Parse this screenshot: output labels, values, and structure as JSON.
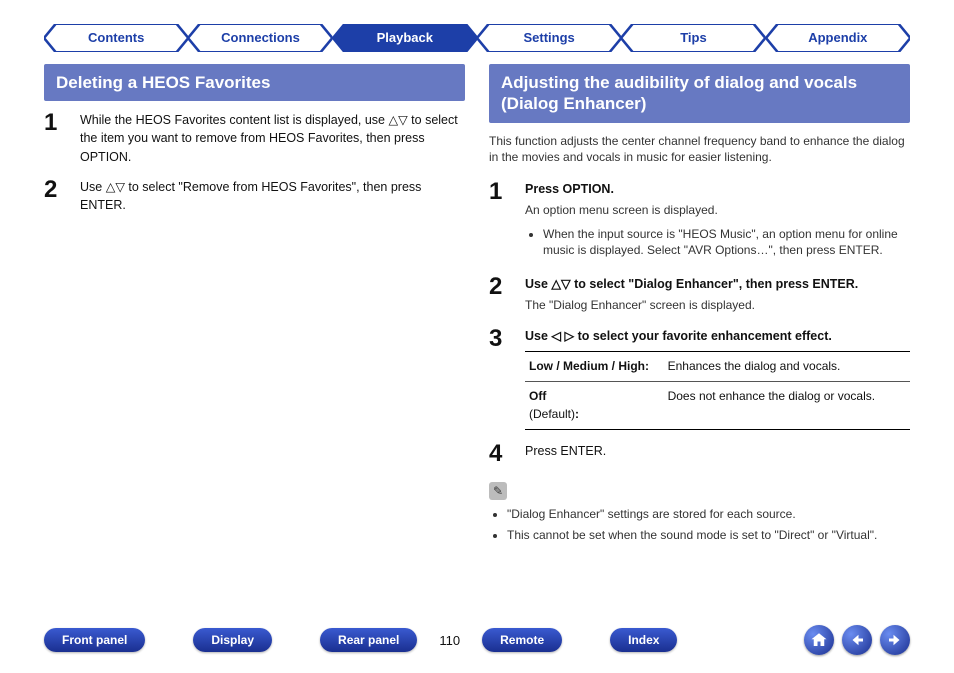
{
  "tabs": {
    "contents": "Contents",
    "connections": "Connections",
    "playback": "Playback",
    "settings": "Settings",
    "tips": "Tips",
    "appendix": "Appendix",
    "active": "playback"
  },
  "left": {
    "heading": "Deleting a HEOS Favorites",
    "step1_pre": "While the HEOS Favorites content list is displayed, use ",
    "step1_post": " to select the item you want to remove from HEOS Favorites, then press OPTION.",
    "step2_pre": "Use ",
    "step2_post": " to select \"Remove from HEOS Favorites\", then press ENTER."
  },
  "right": {
    "heading": "Adjusting the audibility of dialog and vocals (Dialog Enhancer)",
    "intro": "This function adjusts the center channel frequency band to enhance the dialog in the movies and vocals in music for easier listening.",
    "step1_b": "Press OPTION.",
    "step1_sub": "An option menu screen is displayed.",
    "step1_bullet": "When the input source is \"HEOS Music\", an option menu for online music is displayed. Select \"AVR Options…\", then press ENTER.",
    "step2_pre": "Use ",
    "step2_post": " to select \"Dialog Enhancer\", then press ENTER.",
    "step2_sub": "The \"Dialog Enhancer\" screen is displayed.",
    "step3_pre": "Use ",
    "step3_post": " to select your favorite enhancement effect.",
    "table": {
      "r1_label": "Low / Medium / High:",
      "r1_desc": "Enhances the dialog and vocals.",
      "r2_label": "Off",
      "r2_sublabel": "(Default)",
      "r2_colon": ":",
      "r2_desc": "Does not enhance the dialog or vocals."
    },
    "step4_b": "Press ENTER.",
    "notes": {
      "n1": "\"Dialog Enhancer\" settings are stored for each source.",
      "n2": "This cannot be set when the sound mode is set to \"Direct\" or \"Virtual\"."
    }
  },
  "bottom": {
    "front_panel": "Front panel",
    "display": "Display",
    "rear_panel": "Rear panel",
    "page": "110",
    "remote": "Remote",
    "index": "Index"
  },
  "glyphs": {
    "updown": "△▽",
    "leftright": "◁ ▷",
    "pencil": "✎"
  }
}
